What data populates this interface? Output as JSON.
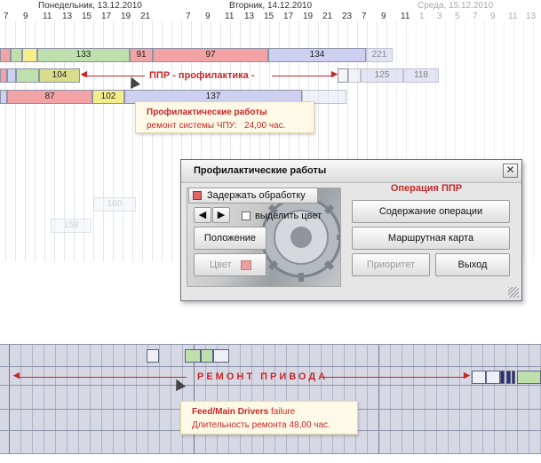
{
  "timeline": {
    "days": [
      "Понедельник, 13.12.2010",
      "Вторник, 14.12.2010",
      "Среда, 15.12.2010"
    ],
    "hours_day1": [
      "7",
      "9",
      "11",
      "13",
      "15",
      "17",
      "19",
      "21"
    ],
    "hours_day2": [
      "7",
      "9",
      "11",
      "13",
      "15",
      "17",
      "19",
      "21",
      "23",
      "7",
      "9",
      "11"
    ],
    "hours_day3": [
      "1",
      "3",
      "5",
      "7",
      "9",
      "11",
      "13"
    ]
  },
  "rows": {
    "row1": [
      "133",
      "91",
      "97",
      "134",
      "221"
    ],
    "row2": [
      "104",
      "125",
      "118"
    ],
    "row3": [
      "87",
      "102",
      "137"
    ],
    "ghost": [
      "160",
      "159"
    ]
  },
  "annotations": {
    "ppr": "ППР - профилактика -",
    "repair": "РЕМОНТ ПРИВОДА"
  },
  "tooltip_top": {
    "title": "Профилактические работы",
    "body_label": "ремонт системы ЧПУ:",
    "body_value": "24,00 час."
  },
  "tooltip_bottom": {
    "title_bold": "Feed/Main Drivers",
    "title_rest": "failure",
    "body": "Длительность ремонта 48,00 час."
  },
  "dialog": {
    "title": "Профилактические работы",
    "close": "✕",
    "hold_label": "Задержать обработку",
    "highlight_label": "выделить цвет",
    "position_btn": "Положение",
    "color_btn": "Цвет",
    "operation_title": "Операция ППР",
    "content_btn": "Содержание операции",
    "route_btn": "Маршрутная карта",
    "priority_btn": "Приоритет",
    "exit_btn": "Выход"
  },
  "colors": {
    "accent_red": "#c62828",
    "bar_pink": "#f1a3a6",
    "bar_yellow": "#f3ee8a",
    "bar_green": "#bfe0ad",
    "bar_lavender": "#cdd0ee",
    "bar_olive": "#d8dd8c"
  }
}
